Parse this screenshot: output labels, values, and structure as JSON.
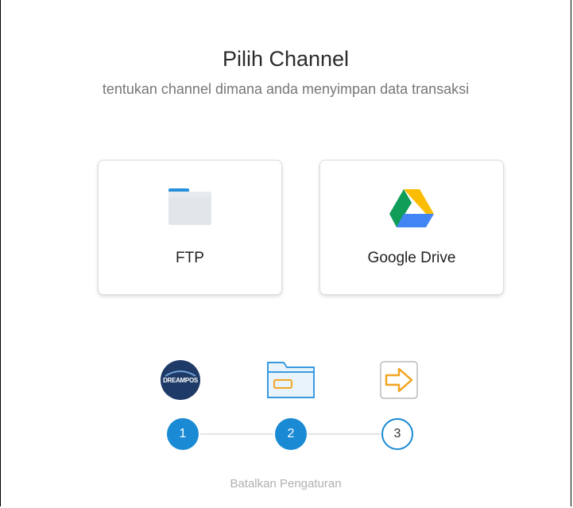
{
  "header": {
    "title": "Pilih Channel",
    "subtitle": "tentukan channel dimana anda menyimpan data transaksi"
  },
  "channels": [
    {
      "label": "FTP",
      "icon": "folder-icon"
    },
    {
      "label": "Google Drive",
      "icon": "google-drive-icon"
    }
  ],
  "steps": [
    {
      "number": "1",
      "icon": "dreampos-logo",
      "logo_text": "DREAMPOS",
      "state": "active"
    },
    {
      "number": "2",
      "icon": "folder-card-icon",
      "state": "active"
    },
    {
      "number": "3",
      "icon": "arrow-right-icon",
      "state": "inactive"
    }
  ],
  "footer": {
    "cancel_label": "Batalkan Pengaturan"
  },
  "colors": {
    "accent": "#1a8ad4",
    "logo_bg": "#1e3a66",
    "arrow": "#f0a623",
    "folder_tab": "#2690dc",
    "folder_body": "#e2e6ea"
  }
}
